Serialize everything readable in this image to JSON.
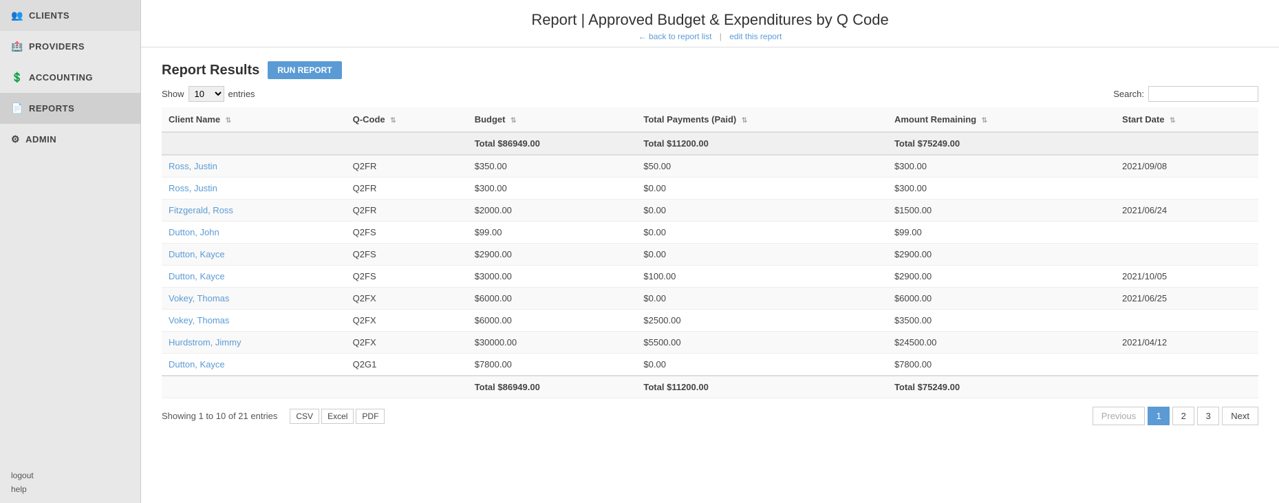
{
  "sidebar": {
    "items": [
      {
        "id": "clients",
        "label": "CLIENTS",
        "icon": "👥",
        "active": false
      },
      {
        "id": "providers",
        "label": "PROVIDERS",
        "icon": "🏥",
        "active": false
      },
      {
        "id": "accounting",
        "label": "ACCOUNTING",
        "icon": "💲",
        "active": false
      },
      {
        "id": "reports",
        "label": "REPORTS",
        "icon": "📄",
        "active": true
      },
      {
        "id": "admin",
        "label": "ADMIN",
        "icon": "⚙",
        "active": false
      }
    ],
    "logout_label": "logout",
    "help_label": "help"
  },
  "header": {
    "title": "Report | Approved Budget & Expenditures by Q Code",
    "back_link": "← back to report list",
    "separator": "|",
    "edit_link": "edit this report"
  },
  "report": {
    "title": "Report Results",
    "run_btn": "RUN REPORT",
    "show_label": "Show",
    "show_value": "10",
    "entries_label": "entries",
    "search_label": "Search:",
    "search_placeholder": "",
    "columns": [
      {
        "id": "client_name",
        "label": "Client Name"
      },
      {
        "id": "q_code",
        "label": "Q-Code"
      },
      {
        "id": "budget",
        "label": "Budget"
      },
      {
        "id": "total_payments",
        "label": "Total Payments (Paid)"
      },
      {
        "id": "amount_remaining",
        "label": "Amount Remaining"
      },
      {
        "id": "start_date",
        "label": "Start Date"
      }
    ],
    "totals_top": {
      "budget": "Total $86949.00",
      "total_payments": "Total $11200.00",
      "amount_remaining": "Total $75249.00"
    },
    "rows": [
      {
        "client_name": "Ross, Justin",
        "q_code": "Q2FR",
        "budget": "$350.00",
        "total_payments": "$50.00",
        "amount_remaining": "$300.00",
        "start_date": "2021/09/08"
      },
      {
        "client_name": "Ross, Justin",
        "q_code": "Q2FR",
        "budget": "$300.00",
        "total_payments": "$0.00",
        "amount_remaining": "$300.00",
        "start_date": ""
      },
      {
        "client_name": "Fitzgerald, Ross",
        "q_code": "Q2FR",
        "budget": "$2000.00",
        "total_payments": "$0.00",
        "amount_remaining": "$1500.00",
        "start_date": "2021/06/24"
      },
      {
        "client_name": "Dutton, John",
        "q_code": "Q2FS",
        "budget": "$99.00",
        "total_payments": "$0.00",
        "amount_remaining": "$99.00",
        "start_date": ""
      },
      {
        "client_name": "Dutton, Kayce",
        "q_code": "Q2FS",
        "budget": "$2900.00",
        "total_payments": "$0.00",
        "amount_remaining": "$2900.00",
        "start_date": ""
      },
      {
        "client_name": "Dutton, Kayce",
        "q_code": "Q2FS",
        "budget": "$3000.00",
        "total_payments": "$100.00",
        "amount_remaining": "$2900.00",
        "start_date": "2021/10/05"
      },
      {
        "client_name": "Vokey, Thomas",
        "q_code": "Q2FX",
        "budget": "$6000.00",
        "total_payments": "$0.00",
        "amount_remaining": "$6000.00",
        "start_date": "2021/06/25"
      },
      {
        "client_name": "Vokey, Thomas",
        "q_code": "Q2FX",
        "budget": "$6000.00",
        "total_payments": "$2500.00",
        "amount_remaining": "$3500.00",
        "start_date": ""
      },
      {
        "client_name": "Hurdstrom, Jimmy",
        "q_code": "Q2FX",
        "budget": "$30000.00",
        "total_payments": "$5500.00",
        "amount_remaining": "$24500.00",
        "start_date": "2021/04/12"
      },
      {
        "client_name": "Dutton, Kayce",
        "q_code": "Q2G1",
        "budget": "$7800.00",
        "total_payments": "$0.00",
        "amount_remaining": "$7800.00",
        "start_date": ""
      }
    ],
    "totals_bottom": {
      "budget": "Total $86949.00",
      "total_payments": "Total $11200.00",
      "amount_remaining": "Total $75249.00"
    },
    "showing_text": "Showing 1 to 10 of 21 entries",
    "export_btns": [
      "CSV",
      "Excel",
      "PDF"
    ],
    "pagination": {
      "previous": "Previous",
      "next": "Next",
      "pages": [
        "1",
        "2",
        "3"
      ],
      "active_page": "1"
    }
  }
}
